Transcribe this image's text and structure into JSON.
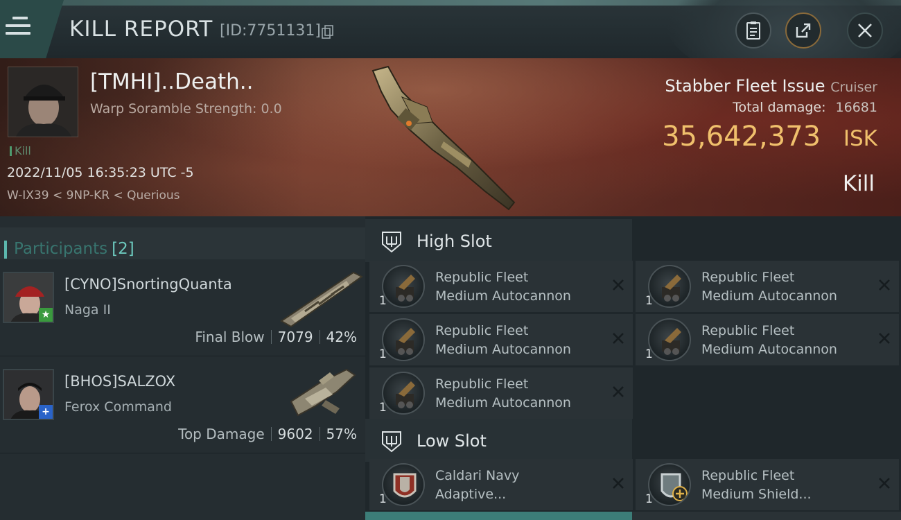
{
  "header": {
    "title": "KILL REPORT",
    "report_id": "[ID:7751131]",
    "icons": [
      "menu-icon",
      "copy-icon",
      "report-icon",
      "share-icon",
      "close-icon"
    ]
  },
  "victim": {
    "name": "[TMHI]..Death..",
    "warp_scramble": "Warp Soramble Strength: 0.0",
    "tag": "Kill",
    "datetime": "2022/11/05 16:35:23 UTC -5",
    "location": "W-IX39 < 9NP-KR < Querious",
    "ship_name": "Stabber Fleet Issue",
    "ship_class": "Cruiser",
    "total_damage_label": "Total damage:",
    "total_damage": "16681",
    "isk_value": "35,642,373",
    "isk_unit": "ISK",
    "result": "Kill"
  },
  "participants": {
    "title": "Participants",
    "count": "[2]",
    "attackers": [
      {
        "name": "[CYNO]SnortingQuanta",
        "ship": "Naga II",
        "role": "Final Blow",
        "damage": "7079",
        "percent": "42%",
        "badge": "★",
        "badge_color": "#3a9a3e"
      },
      {
        "name": "[BHOS]SALZOX",
        "ship": "Ferox Command",
        "role": "Top Damage",
        "damage": "9602",
        "percent": "57%",
        "badge": "+",
        "badge_color": "#2a63c8"
      }
    ]
  },
  "slots": {
    "high": {
      "title": "High Slot",
      "items": [
        {
          "qty": "1",
          "line1": "Republic Fleet",
          "line2": "Medium Autocannon"
        },
        {
          "qty": "1",
          "line1": "Republic Fleet",
          "line2": "Medium Autocannon"
        },
        {
          "qty": "1",
          "line1": "Republic Fleet",
          "line2": "Medium Autocannon"
        },
        {
          "qty": "1",
          "line1": "Republic Fleet",
          "line2": "Medium Autocannon"
        },
        {
          "qty": "1",
          "line1": "Republic Fleet",
          "line2": "Medium Autocannon"
        }
      ]
    },
    "low": {
      "title": "Low Slot",
      "items": [
        {
          "qty": "1",
          "line1": "Caldari Navy",
          "line2": "Adaptive..."
        },
        {
          "qty": "1",
          "line1": "Republic Fleet",
          "line2": "Medium Shield..."
        }
      ]
    }
  },
  "colors": {
    "accent_teal": "#5cb8ae",
    "isk_gold": "#f0c06c",
    "banner_red": "#6a3a2c"
  }
}
